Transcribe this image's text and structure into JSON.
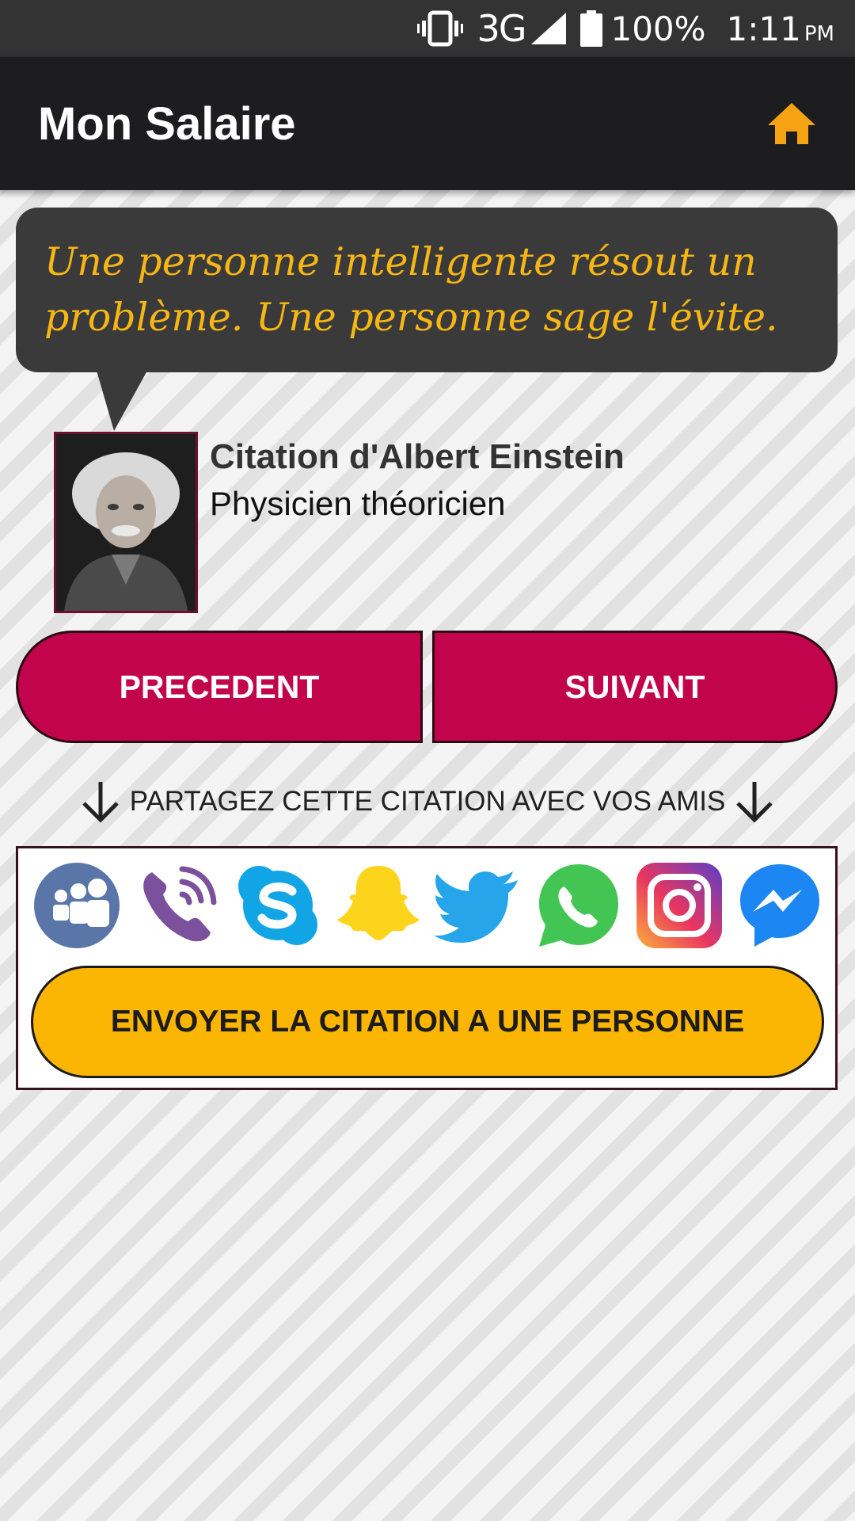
{
  "status_bar": {
    "network": "3G",
    "battery": "100%",
    "time": "1:11",
    "ampm": "PM"
  },
  "app_bar": {
    "title": "Mon Salaire",
    "home_icon": "home-icon"
  },
  "quote": {
    "text": "Une personne intelligente résout un problème. Une personne sage l'évite."
  },
  "author": {
    "name": "Citation d'Albert Einstein",
    "title": "Physicien théoricien"
  },
  "navigation": {
    "previous_label": "PRECEDENT",
    "next_label": "SUIVANT"
  },
  "share": {
    "hint": "PARTAGEZ CETTE CITATION AVEC VOS AMIS",
    "icons": [
      "myspace-icon",
      "viber-icon",
      "skype-icon",
      "snapchat-icon",
      "twitter-icon",
      "whatsapp-icon",
      "instagram-icon",
      "messenger-icon"
    ],
    "send_label": "ENVOYER LA CITATION A UNE PERSONNE"
  },
  "colors": {
    "accent": "#f6b614",
    "nav_button": "#c2044c",
    "send_button": "#fbb503",
    "app_bar": "#1d1d1f",
    "bubble": "#3a3a3a"
  }
}
